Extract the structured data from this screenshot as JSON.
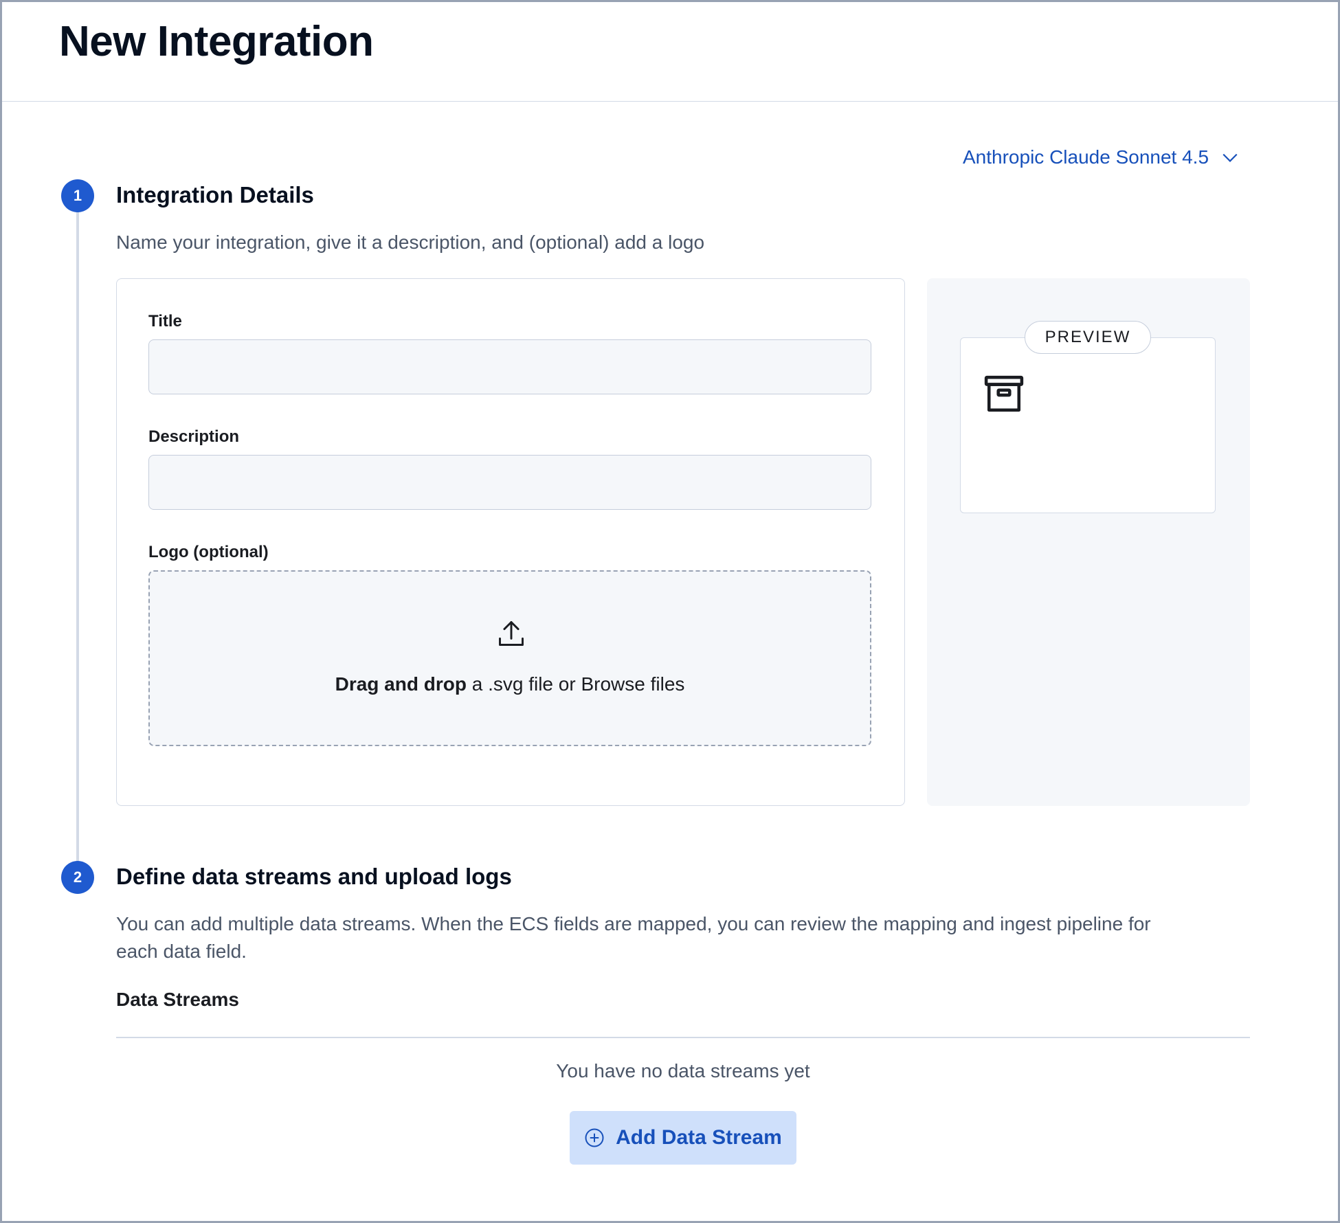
{
  "header": {
    "title": "New Integration"
  },
  "model_selector": {
    "label": "Anthropic Claude Sonnet 4.5",
    "icon": "chevron-down-icon"
  },
  "steps": [
    {
      "number": "1",
      "title": "Integration Details",
      "description": "Name your integration, give it a description, and (optional) add a logo"
    },
    {
      "number": "2",
      "title": "Define data streams and upload logs",
      "description_line1": "You can add multiple data streams. When the ECS fields are mapped, you can review the mapping and ingest pipeline for",
      "description_line2": "each data field."
    }
  ],
  "form": {
    "title_label": "Title",
    "title_value": "",
    "description_label": "Description",
    "description_value": "",
    "logo_label": "Logo (optional)",
    "dropzone_bold": "Drag and drop",
    "dropzone_rest": " a .svg file or Browse files",
    "upload_icon": "upload-icon"
  },
  "preview": {
    "badge": "PREVIEW",
    "icon": "archive-box-icon"
  },
  "data_streams": {
    "heading": "Data Streams",
    "empty_message": "You have no data streams yet",
    "add_button_label": "Add Data Stream",
    "add_button_icon": "plus-circle-icon"
  },
  "colors": {
    "accent": "#1f5acf",
    "link": "#1750ba",
    "button_bg": "#cfe0fb",
    "panel_bg": "#f5f7fa",
    "border": "#d3dae6"
  }
}
